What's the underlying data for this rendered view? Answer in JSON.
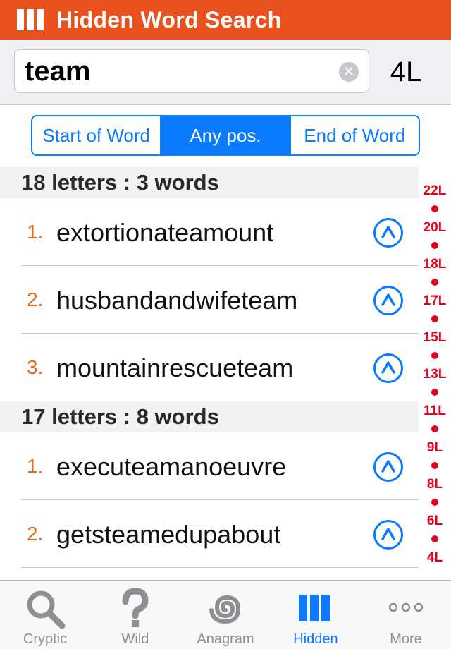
{
  "header": {
    "title": "Hidden Word Search",
    "logo_icon": "columns-icon",
    "bg_color": "#e8501e"
  },
  "search": {
    "value": "team",
    "clear_icon": "clear-icon",
    "length_label": "4L"
  },
  "segments": [
    {
      "label": "Start of Word",
      "active": false
    },
    {
      "label": "Any pos.",
      "active": true
    },
    {
      "label": "End of Word",
      "active": false
    }
  ],
  "sections": [
    {
      "header": "18 letters : 3 words",
      "rows": [
        {
          "num": "1.",
          "word": "extortionateamount"
        },
        {
          "num": "2.",
          "word": "husbandandwifeteam"
        },
        {
          "num": "3.",
          "word": "mountainrescueteam"
        }
      ]
    },
    {
      "header": "17 letters : 8 words",
      "rows": [
        {
          "num": "1.",
          "word": "executeamanoeuvre"
        },
        {
          "num": "2.",
          "word": "getsteamedupabout"
        }
      ]
    }
  ],
  "index_bar": [
    "22L",
    "20L",
    "18L",
    "17L",
    "15L",
    "13L",
    "11L",
    "9L",
    "8L",
    "6L",
    "4L"
  ],
  "tabs": [
    {
      "label": "Cryptic",
      "icon": "magnifier-icon",
      "active": false
    },
    {
      "label": "Wild",
      "icon": "question-icon",
      "active": false
    },
    {
      "label": "Anagram",
      "icon": "spiral-icon",
      "active": false
    },
    {
      "label": "Hidden",
      "icon": "columns-icon",
      "active": true
    },
    {
      "label": "More",
      "icon": "more-icon",
      "active": false
    }
  ],
  "colors": {
    "accent": "#0a7aff",
    "number": "#e8691e",
    "index": "#e6001f"
  }
}
